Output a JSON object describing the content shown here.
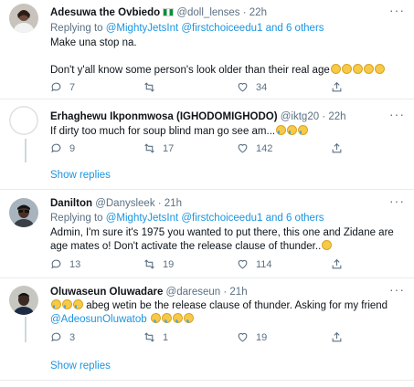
{
  "tweets": [
    {
      "name": "Adesuwa the Ovbiedo",
      "handle": "@doll_lenses",
      "time": "· 22h",
      "replying_prefix": "Replying to ",
      "replying_users": "@MightyJetsInt @firstchoiceedu1",
      "replying_suffix": " and 6 others",
      "line1": "Make una stop na.",
      "line2": "Don't y'all know some person's look older than their real age",
      "replies": "7",
      "retweets": "",
      "likes": "34"
    },
    {
      "name": "Erhaghewu Ikponmwosa (IGHODOMIGHODO)",
      "handle": "@iktg20",
      "time": "· 22h",
      "line1": "If dirty too much for soup blind man go see am...",
      "replies": "9",
      "retweets": "17",
      "likes": "142",
      "show_replies": "Show replies"
    },
    {
      "name": "Danilton",
      "handle": "@Danysleek",
      "time": "· 21h",
      "replying_prefix": "Replying to ",
      "replying_users": "@MightyJetsInt @firstchoiceedu1",
      "replying_suffix": " and 6 others",
      "line1": "Admin, I'm sure it's 1975 you wanted to put there, this one and Zidane are",
      "line2": "age mates o! Don't activate the release clause of thunder..",
      "replies": "13",
      "retweets": "19",
      "likes": "114"
    },
    {
      "name": "Oluwaseun Oluwadare",
      "handle": "@dareseun",
      "time": "· 21h",
      "line1": " abeg wetin be the release clause of thunder. Asking for my friend",
      "mention": "@AdeosunOluwatob",
      "replies": "3",
      "retweets": "1",
      "likes": "19",
      "show_replies": "Show replies"
    }
  ]
}
